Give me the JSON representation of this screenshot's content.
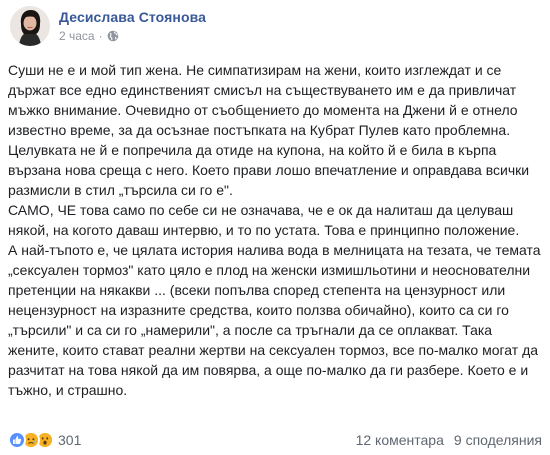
{
  "post": {
    "author": "Десислава Стоянова",
    "time": "2 часа",
    "privacy_icon": "globe-icon",
    "paragraphs": [
      "Суши не е и мой тип жена. Не симпатизирам на жени, които изглеждат и се държат все едно единственият смисъл на съществуването им е да привличат мъжко внимание. Очевидно от съобщението до момента на Джени й е отнело известно време, за да осъзнае постъпката на Кубрат Пулев като проблемна. Целувката не й е попречила да отиде на купона, на който й е била в кърпа вързана нова среща с него. Което прави лошо впечатление и оправдава всички размисли в стил „търсила си го е\".",
      "САМО, ЧЕ това само по себе си не означава, че е ок да налиташ да целуваш някой, на когото даваш интервю, и то по устата. Това е принципно положение.",
      "А най-тъпото е, че цялата история налива вода в мелницата на тезата, че темата „сексуален тормоз\" като цяло е плод на женски измишльотини и неоснователни претенции на някакви ... (всеки попълва според степента на цензурност или нецензурност на изразните средства, които ползва обичайно), които са си го „търсили\" и са си го „намерили\", а после са тръгнали да се оплакват. Така жените, които стават реални жертви на сексуален тормоз, все по-малко могат да разчитат на това някой да им повярва, а още по-малко да ги разбере. Което е и тъжно, и страшно."
    ]
  },
  "footer": {
    "reaction_icons": [
      "like-icon",
      "sad-icon",
      "wow-icon"
    ],
    "reaction_count": "301",
    "comments": "12 коментара",
    "shares": "9 споделяния"
  },
  "colors": {
    "author": "#385898",
    "meta": "#90949c",
    "like": "#5890ff",
    "emoji": "#f7b125"
  }
}
